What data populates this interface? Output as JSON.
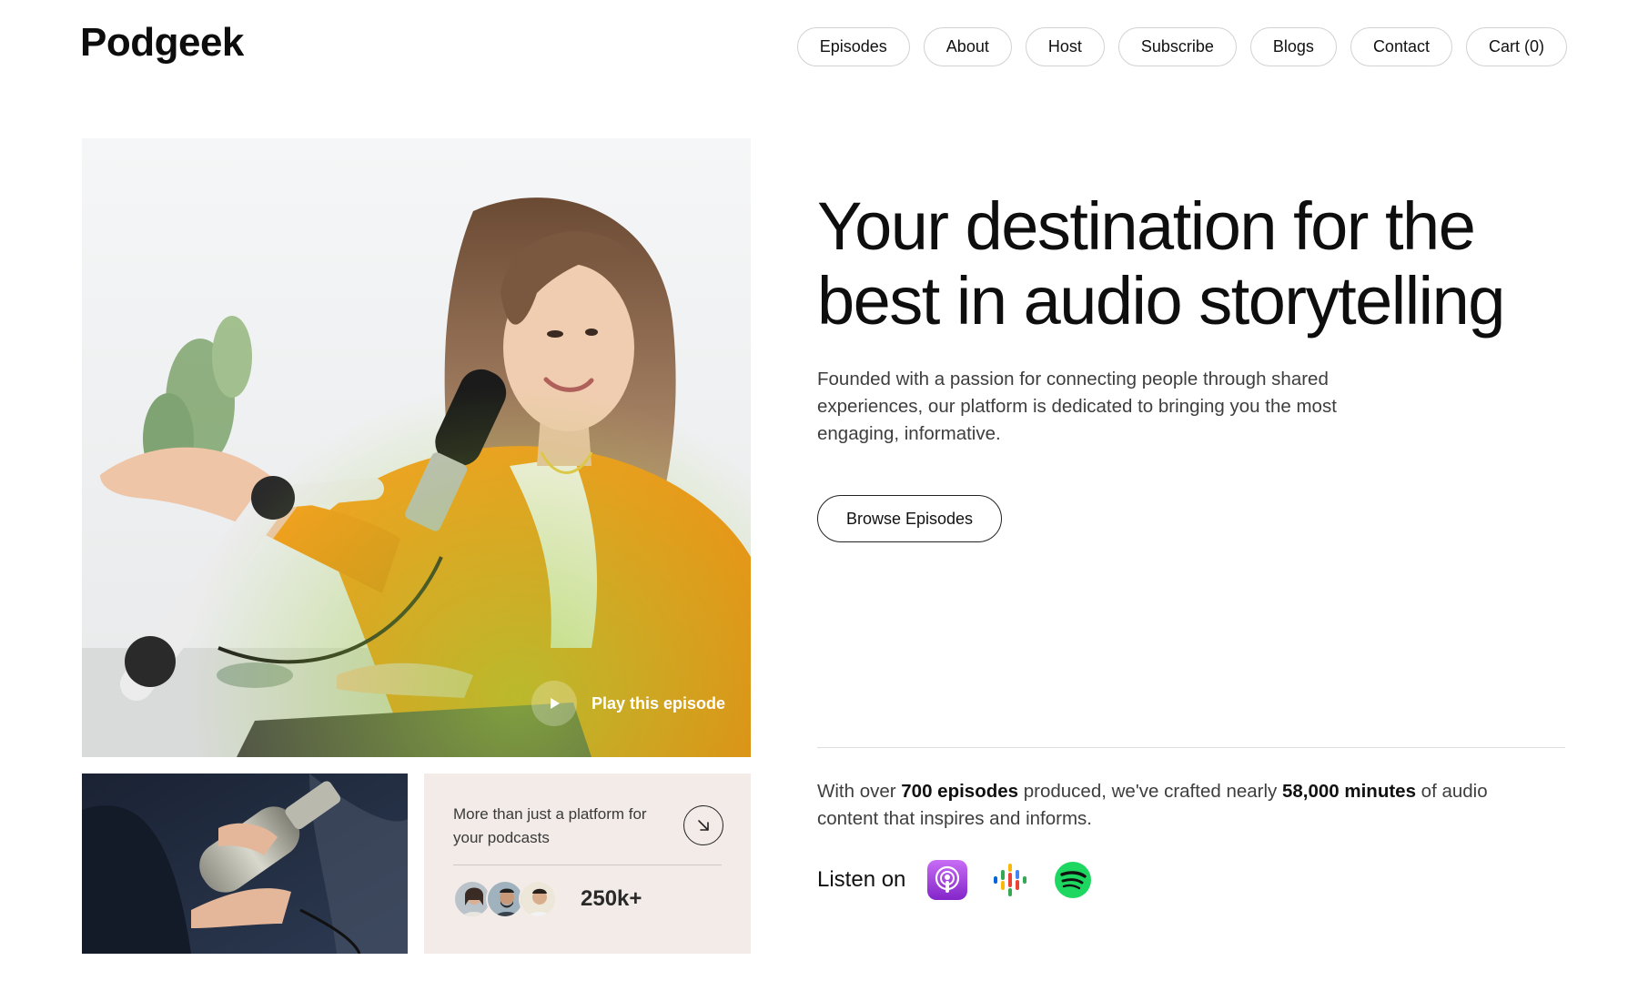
{
  "brand": {
    "logo": "Podgeek"
  },
  "nav": {
    "items": [
      {
        "label": "Episodes"
      },
      {
        "label": "About"
      },
      {
        "label": "Host"
      },
      {
        "label": "Subscribe"
      },
      {
        "label": "Blogs"
      },
      {
        "label": "Contact"
      },
      {
        "label": "Cart (0)"
      }
    ]
  },
  "hero": {
    "headline": "Your destination for the best in audio storytelling",
    "subtitle": "Founded with a passion for connecting people through shared experiences, our platform is dedicated to bringing you the most engaging, informative.",
    "cta_label": "Browse Episodes",
    "play_label": "Play this episode"
  },
  "card": {
    "text": "More than just a platform for your podcasts",
    "count": "250k+",
    "arrow_icon": "arrow-down-right-icon"
  },
  "stats": {
    "prefix": "With over ",
    "episodes": "700 episodes",
    "middle": " produced, we've crafted nearly ",
    "minutes": "58,000 minutes",
    "suffix": " of audio content that inspires and informs."
  },
  "listen": {
    "label": "Listen on",
    "platforms": [
      "apple-podcasts-icon",
      "google-podcasts-icon",
      "spotify-icon"
    ]
  },
  "colors": {
    "accent_orange": "#f39a1c",
    "card_bg": "#f2ebe7",
    "apple_purple": "#9b3fe0",
    "spotify_green": "#1ed760"
  }
}
